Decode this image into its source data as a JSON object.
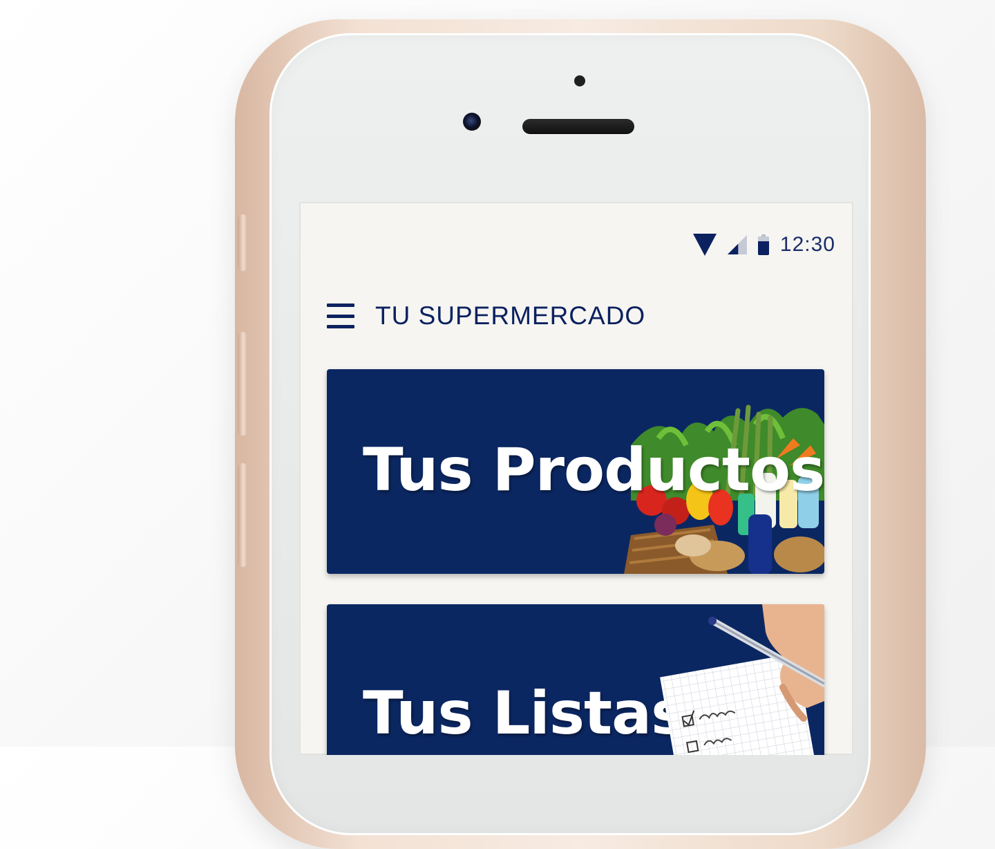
{
  "status_bar": {
    "time": "12:30",
    "icons": [
      "wifi-icon",
      "signal-icon",
      "battery-icon"
    ],
    "battery_level_fraction": 0.75
  },
  "app_bar": {
    "menu_icon": "hamburger-menu-icon",
    "title": "TU SUPERMERCADO"
  },
  "cards": [
    {
      "title": "Tus Productos",
      "image": "groceries-image"
    },
    {
      "title": "Tus Listas",
      "image": "notepad-image"
    }
  ],
  "colors": {
    "primary": "#0b2762",
    "accent_text": "#0b2160",
    "screen_background": "#f6f5f1",
    "phone_body": "#f3e1d4"
  }
}
